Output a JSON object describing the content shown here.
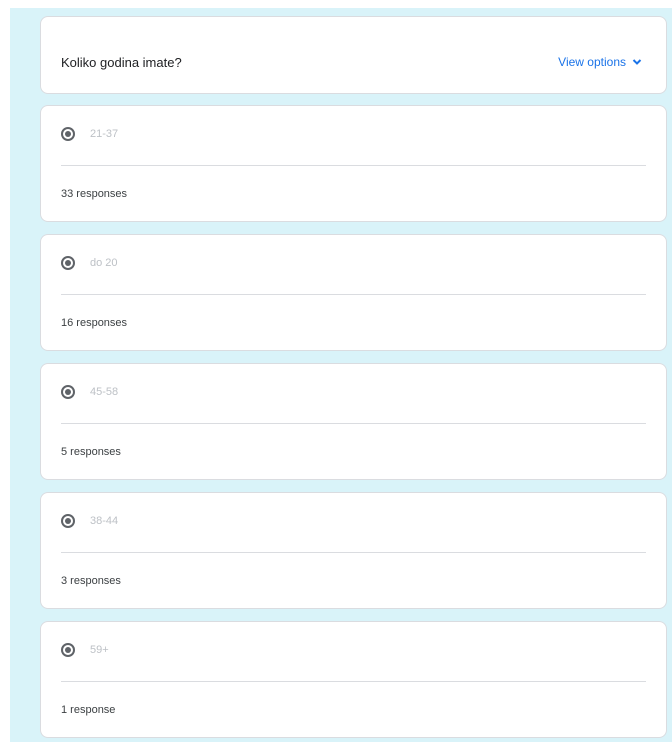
{
  "question": {
    "title": "Koliko godina imate?",
    "view_options_label": "View options"
  },
  "options": [
    {
      "label": "21-37",
      "responses": "33 responses"
    },
    {
      "label": "do 20",
      "responses": "16 responses"
    },
    {
      "label": "45-58",
      "responses": "5 responses"
    },
    {
      "label": "38-44",
      "responses": "3 responses"
    },
    {
      "label": "59+",
      "responses": "1 response"
    }
  ],
  "colors": {
    "background": "#d9f3f9",
    "accent": "#1a73e8"
  },
  "icons": {
    "radio": "radio-selected-icon",
    "chevron": "chevron-down-icon"
  }
}
